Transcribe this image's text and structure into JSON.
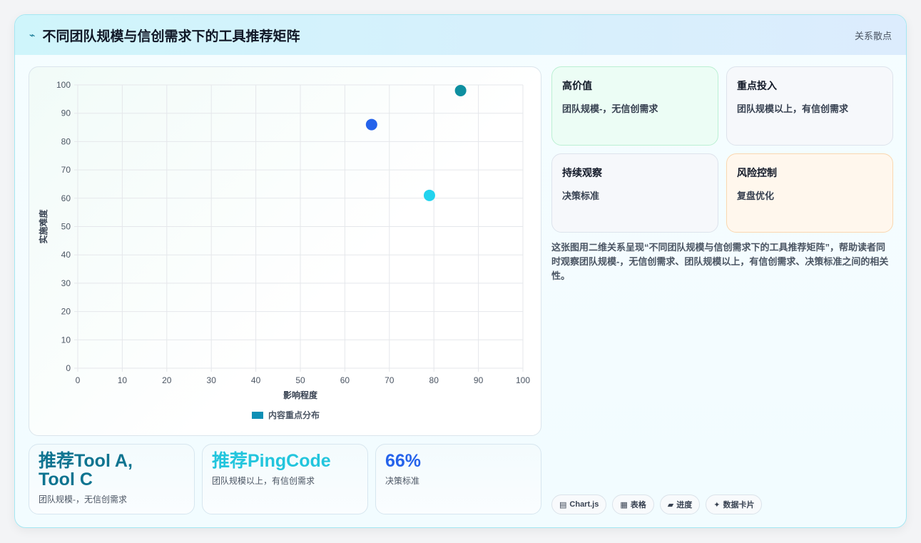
{
  "header": {
    "icon": "lightning-icon",
    "title": "不同团队规模与信创需求下的工具推荐矩阵",
    "tag": "关系散点"
  },
  "chart_data": {
    "type": "scatter",
    "xlabel": "影响程度",
    "ylabel": "实施难度",
    "xlim": [
      0,
      100
    ],
    "ylim": [
      0,
      100
    ],
    "xticks": [
      0,
      10,
      20,
      30,
      40,
      50,
      60,
      70,
      80,
      90,
      100
    ],
    "yticks": [
      0,
      10,
      20,
      30,
      40,
      50,
      60,
      70,
      80,
      90,
      100
    ],
    "grid": true,
    "legend_position": "bottom",
    "series": [
      {
        "name": "内容重点分布",
        "color": "#0e8fb5",
        "points": [
          {
            "x": 66,
            "y": 86,
            "color": "#2563eb"
          },
          {
            "x": 86,
            "y": 98,
            "color": "#0e8fa0"
          },
          {
            "x": 79,
            "y": 61,
            "color": "#22d3ee"
          }
        ]
      }
    ]
  },
  "stats": [
    {
      "value": "推荐Tool A, Tool C",
      "label": "团队规模-，无信创需求",
      "color": "#0e7490"
    },
    {
      "value": "推荐PingCode",
      "label": "团队规模以上，有信创需求",
      "color": "#22c5dd"
    },
    {
      "value": "66%",
      "label": "决策标准",
      "color": "#2563eb"
    }
  ],
  "quadrants": [
    {
      "title": "高价值",
      "text": "团队规模-，无信创需求",
      "bg": "#ecfdf5",
      "border": "#bbf0d3"
    },
    {
      "title": "重点投入",
      "text": "团队规模以上，有信创需求",
      "bg": "#f6f8fb",
      "border": "#dde3ec"
    },
    {
      "title": "持续观察",
      "text": "决策标准",
      "bg": "#f6f8fb",
      "border": "#dde3ec"
    },
    {
      "title": "风险控制",
      "text": "复盘优化",
      "bg": "#fff7ed",
      "border": "#fad7b0"
    }
  ],
  "description": "这张图用二维关系呈现“不同团队规模与信创需求下的工具推荐矩阵”，帮助读者同时观察团队规模-，无信创需求、团队规模以上，有信创需求、决策标准之间的相关性。",
  "chips": [
    {
      "icon": "chart-icon",
      "glyph": "▤",
      "label": "Chart.js"
    },
    {
      "icon": "table-icon",
      "glyph": "▦",
      "label": "表格"
    },
    {
      "icon": "progress-icon",
      "glyph": "▰",
      "label": "进度"
    },
    {
      "icon": "sparkle-icon",
      "glyph": "✦",
      "label": "数据卡片"
    }
  ]
}
